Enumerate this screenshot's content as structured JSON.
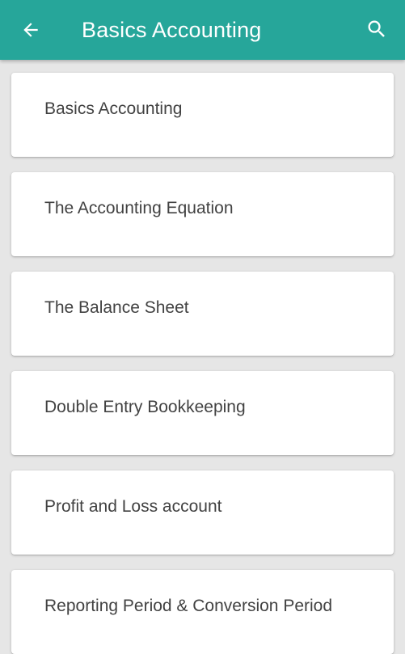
{
  "app_bar": {
    "title": "Basics Accounting",
    "background_color": "#26a69a",
    "back_icon": "arrow-left-icon",
    "search_icon": "search-icon"
  },
  "topics": [
    {
      "label": "Basics Accounting"
    },
    {
      "label": "The Accounting Equation"
    },
    {
      "label": "The Balance Sheet"
    },
    {
      "label": "Double Entry Bookkeeping"
    },
    {
      "label": "Profit and Loss account"
    },
    {
      "label": "Reporting Period & Conversion Period"
    }
  ]
}
